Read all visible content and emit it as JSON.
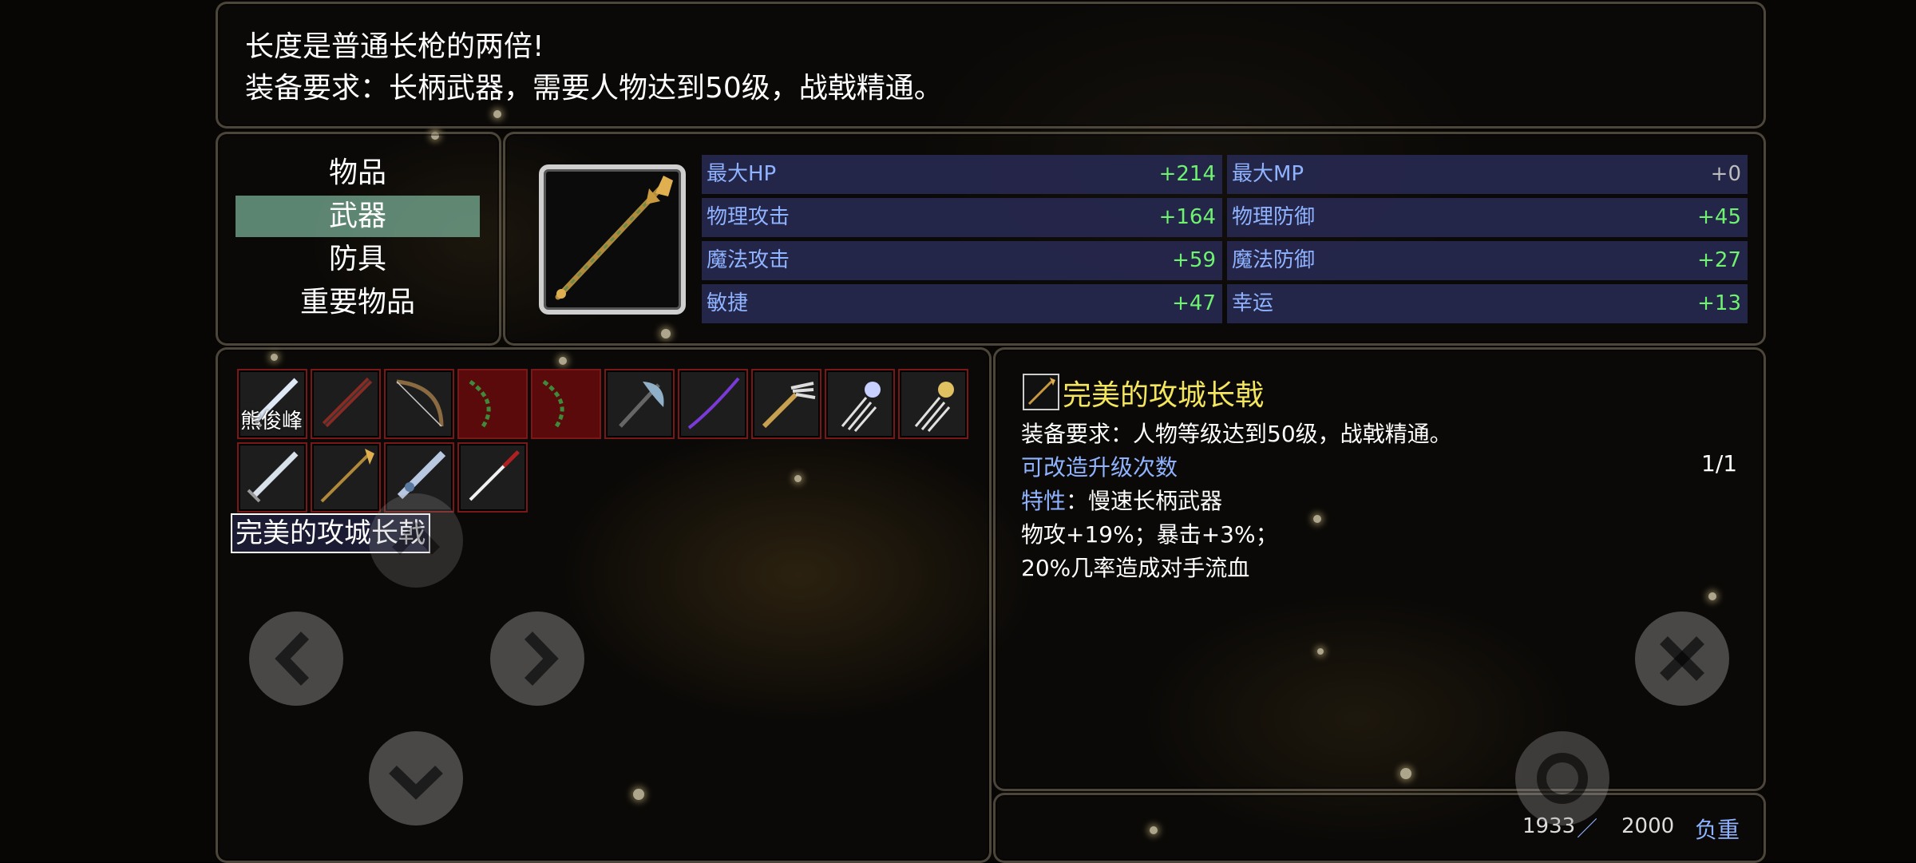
{
  "description": {
    "line1": "长度是普通长枪的两倍!",
    "line2": "装备要求：长柄武器，需要人物达到50级，战戟精通。"
  },
  "categories": [
    {
      "label": "物品",
      "selected": false
    },
    {
      "label": "武器",
      "selected": true
    },
    {
      "label": "防具",
      "selected": false
    },
    {
      "label": "重要物品",
      "selected": false
    }
  ],
  "stats": [
    {
      "name": "最大HP",
      "value": "+214"
    },
    {
      "name": "最大MP",
      "value": "+0"
    },
    {
      "name": "物理攻击",
      "value": "+164"
    },
    {
      "name": "物理防御",
      "value": "+45"
    },
    {
      "name": "魔法攻击",
      "value": "+59"
    },
    {
      "name": "魔法防御",
      "value": "+27"
    },
    {
      "name": "敏捷",
      "value": "+47"
    },
    {
      "name": "幸运",
      "value": "+13"
    }
  ],
  "inventory": {
    "slot_label": "熊俊峰",
    "items": [
      "sword-icon",
      "greatsword-icon",
      "bow-icon",
      "chain-whip-icon",
      "chain-whip-icon",
      "battle-axe-icon",
      "purple-katana-icon",
      "trident-icon",
      "claw-icon",
      "claw-icon",
      "sword-icon",
      "halberd-icon",
      "greatsword-icon",
      "katana-icon"
    ],
    "hover_name": "完美的攻城长戟"
  },
  "detail": {
    "title": "完美的攻城长戟",
    "requirement": "装备要求：人物等级达到50级，战戟精通。",
    "upgrade_label": "可改造升级次数",
    "upgrade_value": "1/1",
    "trait_label": "特性",
    "trait_value": "：慢速长柄武器",
    "effect1": "物攻+19%；暴击+3%；",
    "effect2": "20%几率造成对手流血"
  },
  "weight": {
    "current": "1933",
    "max": "2000",
    "label": "负重"
  },
  "controls": [
    "chevron-up-icon",
    "chevron-left-icon",
    "chevron-right-icon",
    "chevron-down-icon",
    "close-icon",
    "confirm-ring-icon"
  ],
  "colors": {
    "selected_category": "#78af96",
    "stat_name": "#8fb3ff",
    "stat_value": "#6ff26f",
    "title_yellow": "#f3e55d",
    "slot_border": "#7a1818"
  }
}
